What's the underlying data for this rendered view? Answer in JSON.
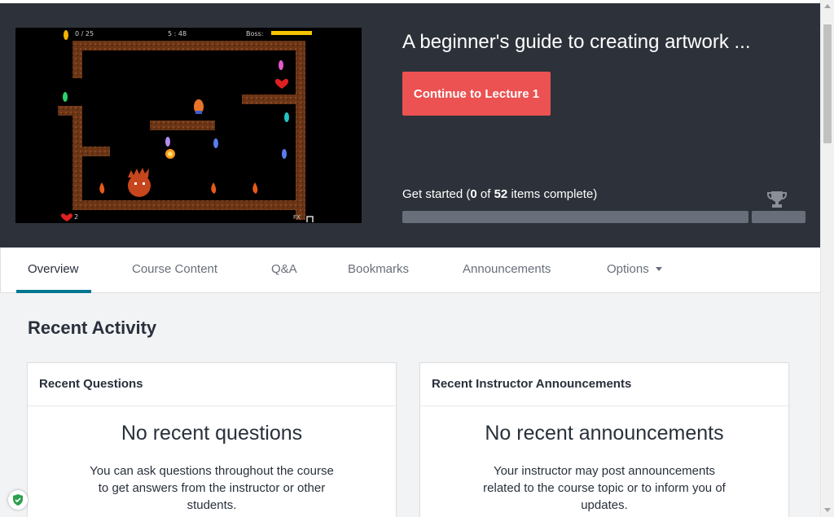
{
  "colors": {
    "hero_bg": "#2d323a",
    "accent_red": "#ec5252",
    "tab_active_underline": "#007791",
    "progress_track": "#686f7a"
  },
  "game": {
    "hud_score": "0 / 25",
    "hud_timer": "5 : 48",
    "hud_boss_label": "Boss:",
    "hud_lives": "2",
    "hud_fx": "FX"
  },
  "course": {
    "title": "A beginner's guide to creating artwork ...",
    "continue_label": "Continue to Lecture 1"
  },
  "progress": {
    "prefix": "Get started (",
    "completed": "0",
    "of_word": "of",
    "total": "52",
    "suffix": "items complete)",
    "fraction_complete": 0,
    "trophy_icon": "trophy-icon"
  },
  "tabs": [
    {
      "label": "Overview",
      "active": true
    },
    {
      "label": "Course Content"
    },
    {
      "label": "Q&A"
    },
    {
      "label": "Bookmarks"
    },
    {
      "label": "Announcements"
    },
    {
      "label": "Options"
    }
  ],
  "recent_activity": {
    "title": "Recent Activity",
    "questions": {
      "header": "Recent Questions",
      "empty_title": "No recent questions",
      "empty_text": "You can ask questions throughout the course to get answers from the instructor or other students."
    },
    "announcements": {
      "header": "Recent Instructor Announcements",
      "empty_title": "No recent announcements",
      "empty_text": "Your instructor may post announcements related to the course topic or to inform you of updates."
    }
  }
}
